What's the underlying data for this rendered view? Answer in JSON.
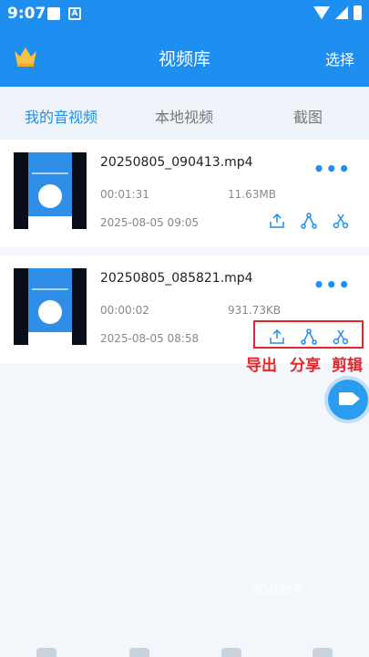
{
  "status_bar": {
    "time": "9:07",
    "notif_badge": "A"
  },
  "header": {
    "title": "视频库",
    "select_label": "选择"
  },
  "tabs": [
    {
      "label": "我的音视频",
      "active": true
    },
    {
      "label": "本地视频",
      "active": false
    },
    {
      "label": "截图",
      "active": false
    }
  ],
  "videos": [
    {
      "filename": "20250805_090413.mp4",
      "duration": "00:01:31",
      "size": "11.63MB",
      "date": "2025-08-05 09:05"
    },
    {
      "filename": "20250805_085821.mp4",
      "duration": "00:00:02",
      "size": "931.73KB",
      "date": "2025-08-05 08:58"
    }
  ],
  "annotations": {
    "export": "导出",
    "share": "分享",
    "cut": "剪辑"
  },
  "watermark": "ROM助手",
  "colors": {
    "accent": "#1e8ff0",
    "highlight": "#e2262b"
  },
  "icons": {
    "crown": "crown-icon",
    "more": "more-icon",
    "export": "export-icon",
    "share": "share-icon",
    "cut": "scissors-icon",
    "fab": "video-camera-icon"
  }
}
